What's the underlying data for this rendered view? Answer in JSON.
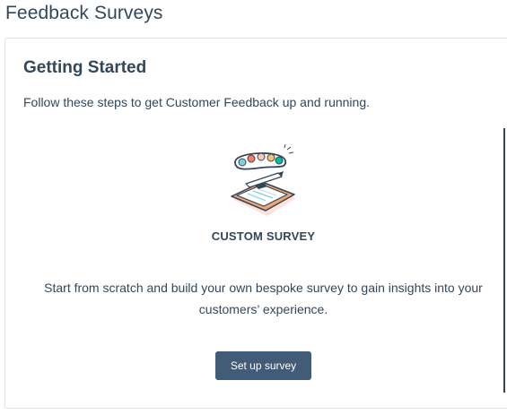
{
  "header": {
    "title": "Feedback Surveys"
  },
  "card": {
    "title": "Getting Started",
    "description": "Follow these steps to get Customer Feedback up and running."
  },
  "option": {
    "icon": "survey-clipboard-illustration",
    "title": "CUSTOM SURVEY",
    "description": "Start from scratch and build your own bespoke survey to gain insights into your customers’ experience.",
    "button_label": "Set up survey"
  },
  "colors": {
    "text": "#33475b",
    "button_bg": "#425b76",
    "border": "#dfe3eb"
  }
}
